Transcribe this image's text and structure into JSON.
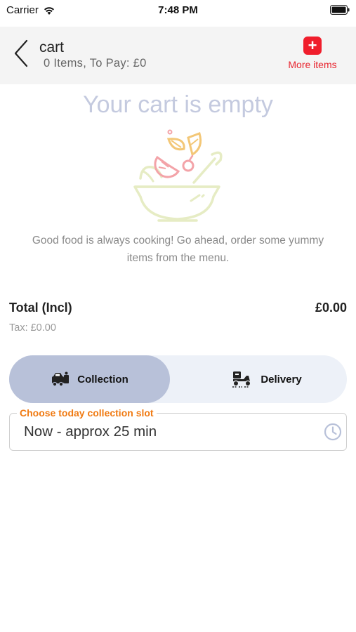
{
  "status_bar": {
    "carrier": "Carrier",
    "time": "7:48 PM"
  },
  "header": {
    "title": "cart",
    "subtitle": "0  Items, To Pay: £0",
    "more_items_label": "More items"
  },
  "empty_state": {
    "title": "Your cart is empty",
    "message": "Good food is always cooking! Go ahead, order some yummy items from the menu."
  },
  "totals": {
    "total_label": "Total (Incl)",
    "total_value": "£0.00",
    "tax": "Tax: £0.00"
  },
  "order_type": {
    "options": [
      "Collection",
      "Delivery"
    ],
    "selected": "Collection"
  },
  "slot": {
    "label": "Choose today collection slot",
    "value": "Now - approx 25 min"
  },
  "colors": {
    "accent_red": "#f01e2c",
    "slot_label_orange": "#f07a12",
    "toggle_active": "#b8c1d9",
    "empty_title": "#c4cadf"
  },
  "icons": [
    "wifi-icon",
    "battery-icon",
    "back-chevron-icon",
    "plus-icon",
    "salad-bowl-icon",
    "collection-icon",
    "delivery-scooter-icon",
    "clock-icon"
  ]
}
